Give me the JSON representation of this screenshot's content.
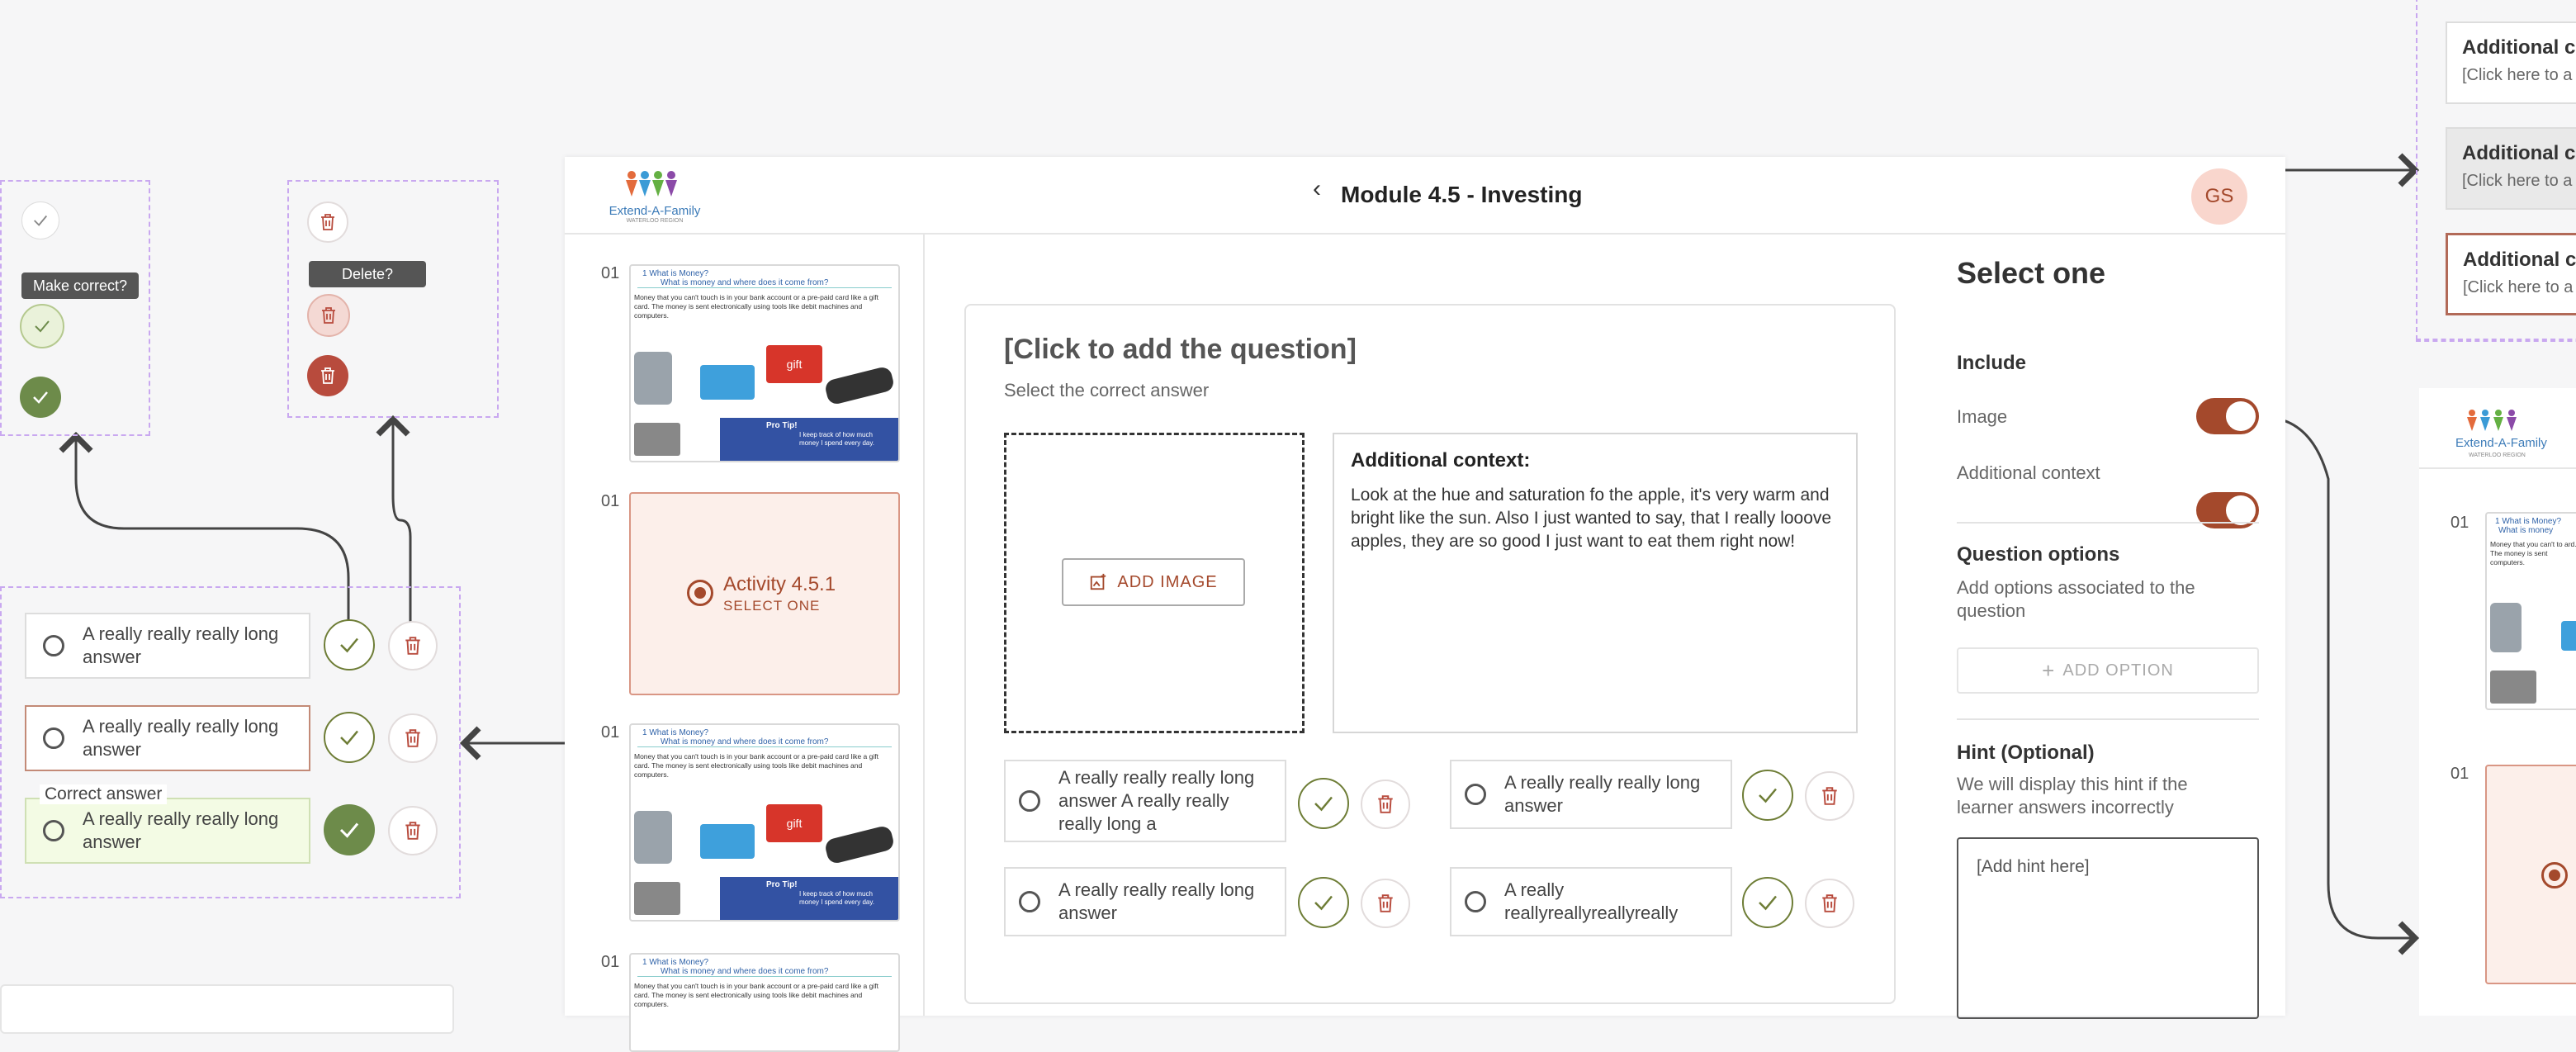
{
  "header": {
    "title": "Module 4.5 - Investing",
    "back_symbol": "‹",
    "avatar_initials": "GS",
    "logo_text": "Extend-A-Family",
    "logo_subtext": "WATERLOO REGION"
  },
  "thumbnails": [
    {
      "number": "01",
      "line1": "1 What is Money?",
      "line2": "What is money and where does it come from?",
      "body": "Money that you can't touch is in your bank account or a pre-paid card like a gift card. The money is sent electronically using tools like debit machines and computers.",
      "gift": "gift",
      "tip_title": "Pro Tip!",
      "tip_body": "I keep track of how much money I spend every day."
    },
    {
      "number": "01",
      "activity_title": "Activity 4.5.1",
      "activity_sub": "SELECT ONE"
    },
    {
      "number": "01",
      "line1": "1 What is Money?",
      "line2": "What is money and where does it come from?",
      "body": "Money that you can't touch is in your bank account or a pre-paid card like a gift card. The money is sent electronically using tools like debit machines and computers.",
      "gift": "gift",
      "tip_title": "Pro Tip!",
      "tip_body": "I keep track of how much money I spend every day."
    },
    {
      "number": "01",
      "line1": "1 What is Money?",
      "line2": "What is money and where does it come from?",
      "body": "Money that you can't touch is in your bank account or a pre-paid card like a gift card. The money is sent electronically using tools like debit machines and computers."
    }
  ],
  "question": {
    "title": "[Click to add the question]",
    "subtitle": "Select the correct answer",
    "add_image": "ADD IMAGE",
    "context_title": "Additional context:",
    "context_body": "Look at the hue and saturation fo the apple, it's very warm and bright like the sun. Also I just wanted to say, that I really looove apples, they are so good I just want to eat them right now!",
    "answers": [
      "A really really really long answer A really really really long a",
      "A really really really long answer",
      "A really really really long answer",
      "A really reallyreallyreallyreally"
    ]
  },
  "settings": {
    "title": "Select one",
    "include_label": "Include",
    "image_label": "Image",
    "context_label": "Additional context",
    "qopts_title": "Question options",
    "qopts_desc": "Add options associated to the question",
    "add_option": "ADD OPTION",
    "hint_title": "Hint (Optional)",
    "hint_desc": "We will display this hint if the learner answers incorrectly",
    "hint_placeholder": "[Add hint here]"
  },
  "annotations": {
    "make_correct": "Make correct?",
    "delete": "Delete?",
    "correct_answer": "Correct answer",
    "answer_text": "A really really really long answer"
  },
  "right_cards": [
    {
      "title": "Additional co",
      "sub": "[Click here to a"
    },
    {
      "title": "Additional co",
      "sub": "[Click here to a"
    },
    {
      "title": "Additional co",
      "sub": "[Click here to a"
    }
  ],
  "right_preview": {
    "logo_text": "Extend-A-Family",
    "logo_subtext": "WATERLOO REGION",
    "number1": "01",
    "line1": "1 What is Money?",
    "line2": "What is money",
    "body": "Money that you can't to ard. The money is sent computers.",
    "number2": "01"
  },
  "colors": {
    "brand": "#a4492c",
    "check_green": "#6d8b4a",
    "delete_red": "#b84b3d",
    "annotation_dash": "#c9a8f0",
    "correct_bg": "#f3fbe4"
  },
  "icons": [
    "check-icon",
    "trash-icon",
    "image-plus-icon",
    "plus-icon",
    "radio-icon",
    "chevron-left-icon"
  ]
}
